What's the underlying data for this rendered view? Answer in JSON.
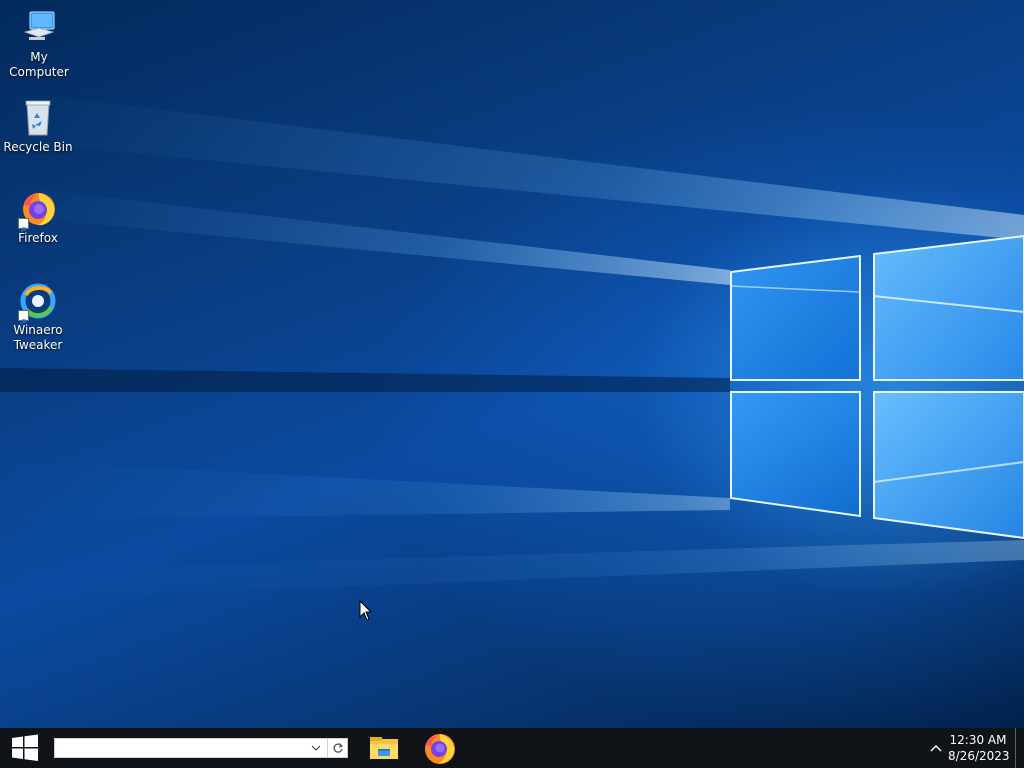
{
  "desktop": {
    "icons": [
      {
        "label": "My Computer",
        "icon": "computer-icon",
        "shortcut": false
      },
      {
        "label": "Recycle Bin",
        "icon": "recycle-bin-icon",
        "shortcut": false
      },
      {
        "label": "Firefox",
        "icon": "firefox-icon",
        "shortcut": true
      },
      {
        "label": "Winaero\nTweaker",
        "icon": "winaero-tweaker-icon",
        "shortcut": true
      }
    ]
  },
  "taskbar": {
    "start_icon": "windows-logo-icon",
    "search": {
      "value": "",
      "placeholder": ""
    },
    "pinned_apps": [
      {
        "name": "File Explorer",
        "icon": "file-explorer-icon"
      },
      {
        "name": "Firefox",
        "icon": "firefox-icon"
      }
    ],
    "tray": {
      "chevron_icon": "chevron-up-icon",
      "time": "12:30 AM",
      "date": "8/26/2023"
    }
  },
  "colors": {
    "taskbar_bg": "#101418",
    "wallpaper_deep": "#02224d",
    "wallpaper_light": "#3aa8ff",
    "firefox_orange": "#ff7a1a",
    "firefox_purple": "#7542e5"
  }
}
